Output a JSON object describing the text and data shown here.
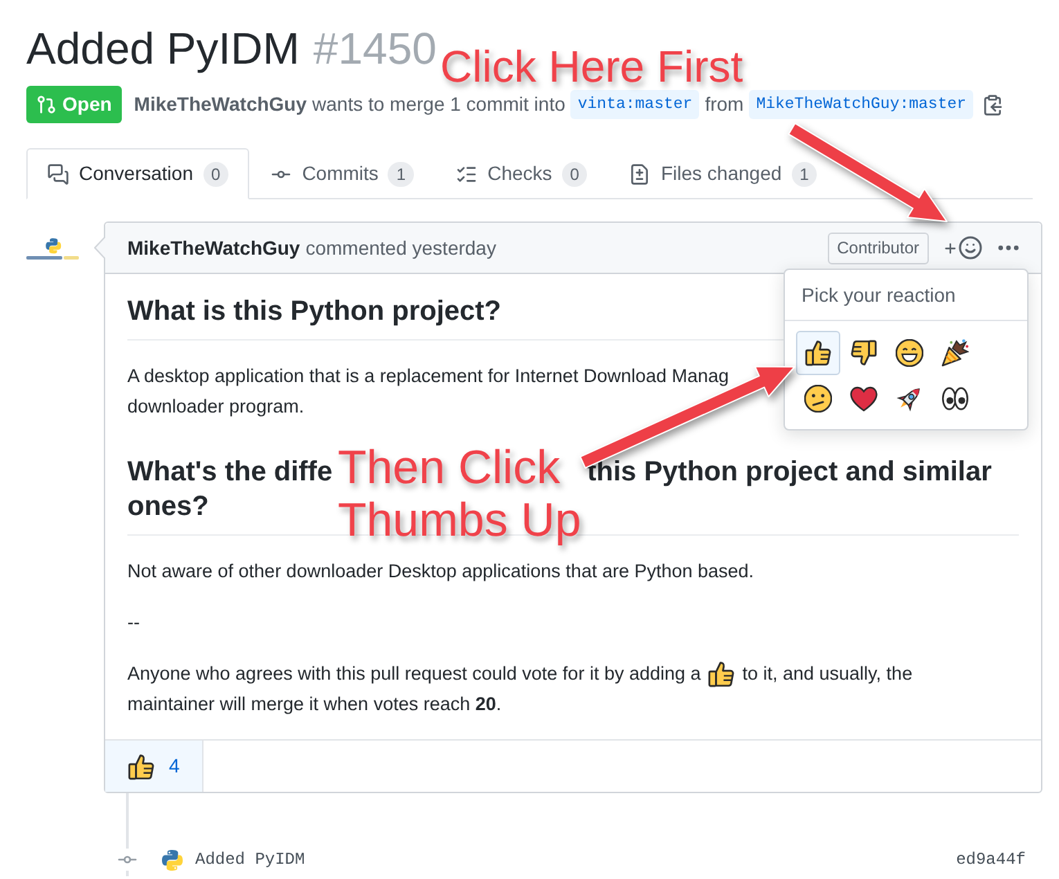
{
  "pull_request": {
    "title": "Added PyIDM",
    "number": "#1450",
    "status": {
      "label": "Open"
    },
    "author": "MikeTheWatchGuy",
    "summary": "wants to merge 1 commit into",
    "base_branch": "vinta:master",
    "joiner": "from",
    "head_branch": "MikeTheWatchGuy:master"
  },
  "tabs": [
    {
      "label": "Conversation",
      "count": "0",
      "selected": true
    },
    {
      "label": "Commits",
      "count": "1",
      "selected": false
    },
    {
      "label": "Checks",
      "count": "0",
      "selected": false
    },
    {
      "label": "Files changed",
      "count": "1",
      "selected": false
    }
  ],
  "comment": {
    "author": "MikeTheWatchGuy",
    "action": "commented yesterday",
    "role_badge": "Contributor",
    "body": [
      {
        "kind": "heading",
        "lines": [
          {
            "segments": [
              "What is this Python project?"
            ]
          }
        ]
      },
      {
        "kind": "lines",
        "lines": [
          "A desktop application that is a replacement for Internet Download Manag",
          "downloader program."
        ]
      },
      {
        "kind": "heading",
        "lines": [
          {
            "segments": [
              "What's the diffe",
              "this Python project and similar"
            ]
          },
          {
            "segments": [
              "ones?"
            ]
          }
        ]
      },
      {
        "kind": "paragraph",
        "text": "Not aware of other downloader Desktop applications that are Python based."
      },
      {
        "kind": "paragraph",
        "text": "--"
      },
      {
        "kind": "vote",
        "before": "Anyone who agrees with this pull request could vote for it by adding a",
        "inline_emoji": {
          "kind": "thumbs_up"
        },
        "after": "to it, and usually, the",
        "continuation": "maintainer will merge it when votes reach **20**."
      }
    ],
    "reactions": [
      {
        "kind": "thumbs_up",
        "count": "4",
        "selected": true
      }
    ]
  },
  "reaction_picker": {
    "title": "Pick your reaction",
    "options": [
      {
        "kind": "thumbs_up",
        "selected": true
      },
      {
        "kind": "thumbs_down",
        "selected": false
      },
      {
        "kind": "laugh",
        "selected": false
      },
      {
        "kind": "hooray",
        "selected": false
      },
      {
        "kind": "confused",
        "selected": false
      },
      {
        "kind": "heart",
        "selected": false
      },
      {
        "kind": "rocket",
        "selected": false
      },
      {
        "kind": "eyes",
        "selected": false
      }
    ]
  },
  "timeline": [
    {
      "kind": "commit",
      "message": "Added PyIDM",
      "sha": "ed9a44f"
    }
  ],
  "annotations": [
    {
      "lines": [
        "Click Here First"
      ]
    },
    {
      "lines": [
        "Then Click",
        "Thumbs Up"
      ]
    }
  ]
}
